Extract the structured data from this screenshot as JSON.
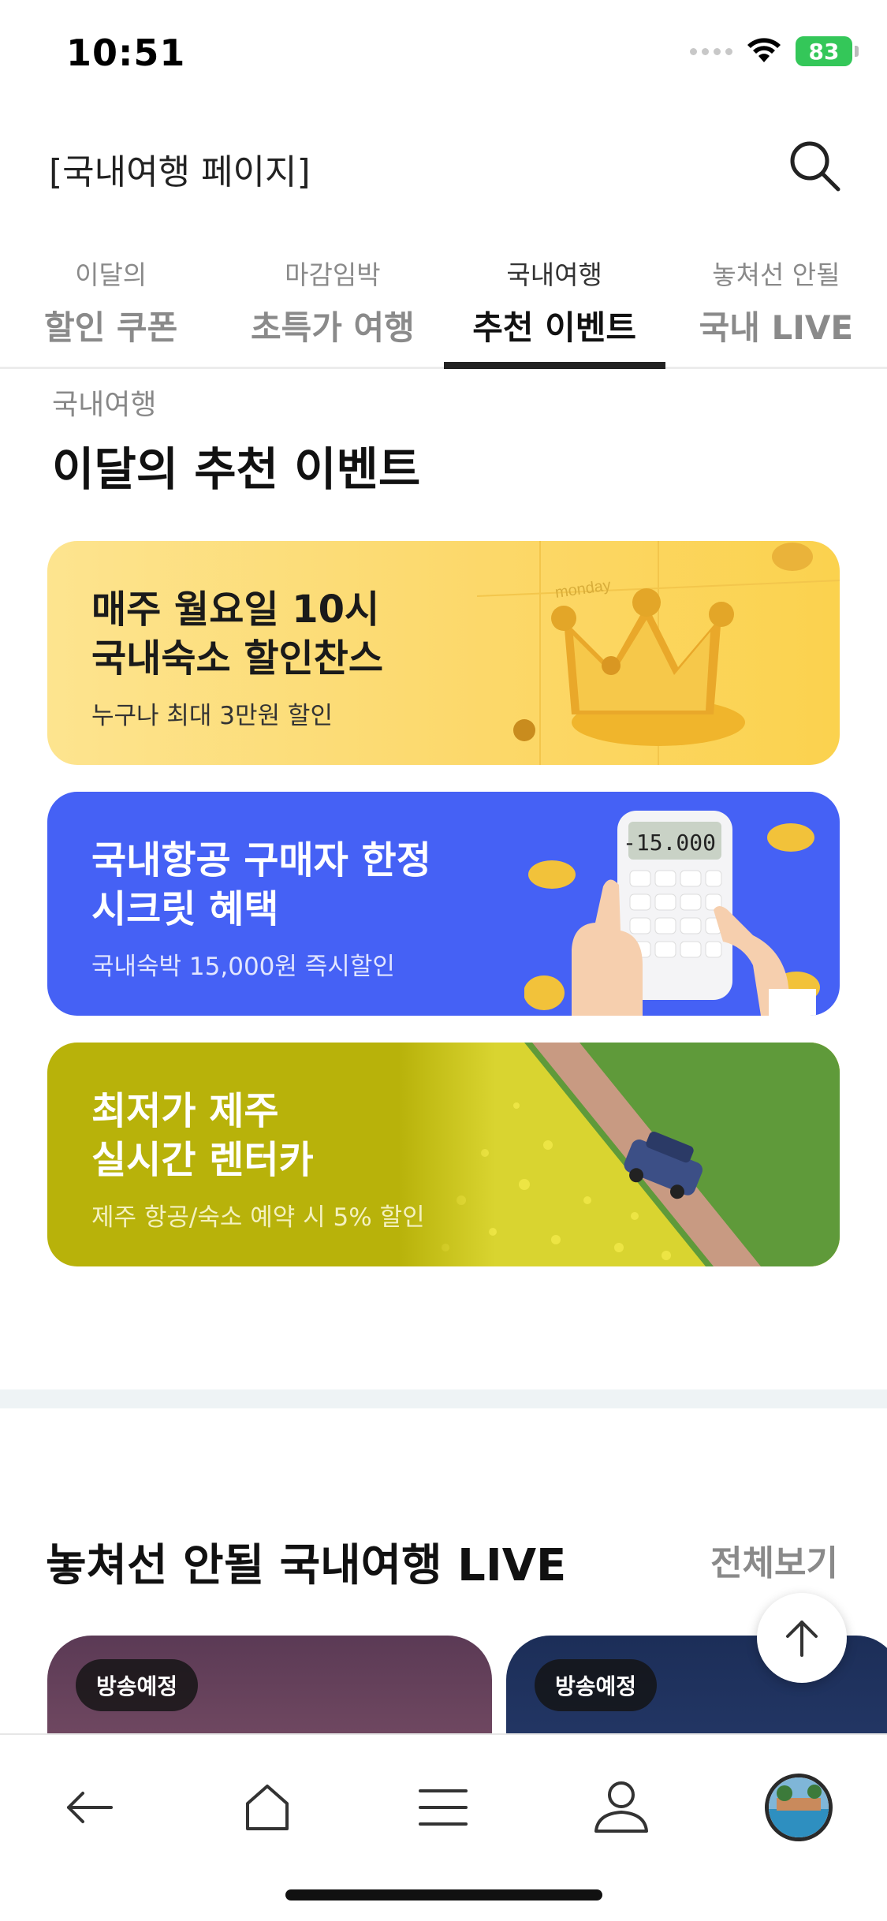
{
  "status_bar": {
    "time": "10:51",
    "battery": "83"
  },
  "header": {
    "title": "[국내여행 페이지]",
    "search_icon": "search-icon"
  },
  "tabs": [
    {
      "sub": "이달의",
      "main": "할인 쿠폰",
      "active": false
    },
    {
      "sub": "마감임박",
      "main": "초특가 여행",
      "active": false
    },
    {
      "sub": "국내여행",
      "main": "추천 이벤트",
      "active": true
    },
    {
      "sub": "놓쳐선 안될",
      "main": "국내 LIVE",
      "active": false
    }
  ],
  "section": {
    "kicker": "국내여행",
    "heading": "이달의 추천 이벤트"
  },
  "banners": [
    {
      "title": "매주 월요일 10시\n국내숙소 할인찬스",
      "subtitle": "누구나 최대 3만원 할인",
      "art": "gold-crown-illustration",
      "art_text": "monday",
      "bg": "#fcd86a"
    },
    {
      "title": "국내항공 구매자 한정\n시크릿 혜택",
      "subtitle": "국내숙박 15,000원 즉시할인",
      "art": "calculator-coins-illustration",
      "art_text": "-15.000",
      "bg": "#4561f5"
    },
    {
      "title": "최저가 제주\n실시간 렌터카",
      "subtitle": "제주 항공/숙소 예약 시 5% 할인",
      "art": "rapeseed-field-car-photo",
      "bg": "#b8b20a"
    }
  ],
  "live": {
    "title": "놓쳐선 안될 국내여행 LIVE",
    "more_label": "전체보기",
    "cards": [
      {
        "badge": "방송예정"
      },
      {
        "badge": "방송예정"
      }
    ]
  },
  "bottom_nav": {
    "items": [
      "back-arrow-icon",
      "home-icon",
      "menu-icon",
      "profile-icon",
      "avatar"
    ]
  },
  "colors": {
    "accent_dark": "#222222",
    "tab_inactive": "#8a8a8a",
    "banner_blue": "#4561f5",
    "banner_yellow": "#fcd86a",
    "banner_olive": "#b8b20a",
    "battery_green": "#34c759"
  }
}
